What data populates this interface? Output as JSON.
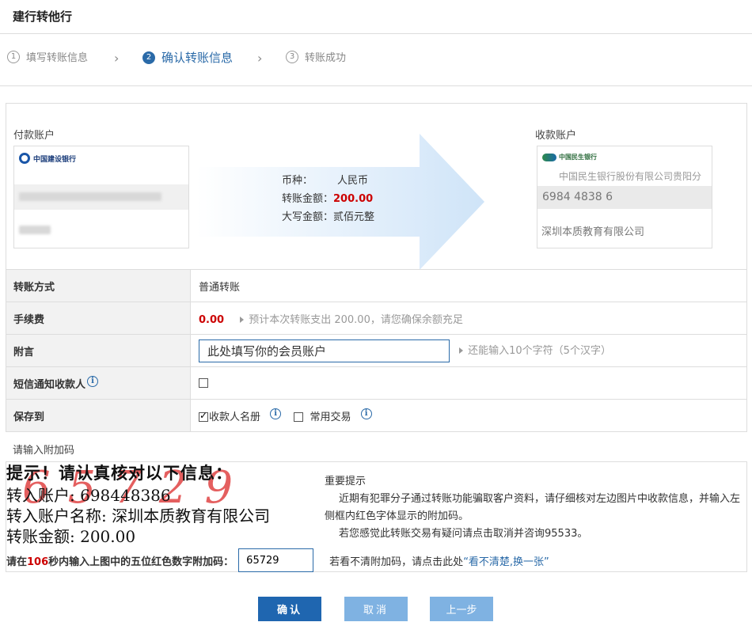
{
  "header": {
    "title": "建行转他行"
  },
  "steps": [
    {
      "num": "1",
      "label": "填写转账信息"
    },
    {
      "num": "2",
      "label": "确认转账信息"
    },
    {
      "num": "3",
      "label": "转账成功"
    }
  ],
  "step_separator": "›",
  "payer": {
    "label": "付款账户",
    "bank_logo_text": "中国建设银行"
  },
  "payee": {
    "label": "收款账户",
    "bank_logo_text": "中国民生银行",
    "bank_name": "中国民生银行股份有限公司贵阳分",
    "account_no": "6984 4838 6",
    "account_name": "深圳本质教育有限公司"
  },
  "amount": {
    "currency_label": "币种：",
    "currency_value": "人民币",
    "amount_label": "转账金额：",
    "amount_value": "200.00",
    "capital_label": "大写金额：",
    "capital_value": "贰佰元整"
  },
  "form": {
    "method_label": "转账方式",
    "method_value": "普通转账",
    "fee_label": "手续费",
    "fee_value": "0.00",
    "fee_hint": "预计本次转账支出 200.00，请您确保余额充足",
    "memo_label": "附言",
    "memo_value": "此处填写你的会员账户",
    "memo_hint": "还能输入10个字符（5个汉字）",
    "sms_label": "短信通知收款人",
    "save_label": "保存到",
    "save_opt1": "收款人名册",
    "save_opt2": "常用交易"
  },
  "captcha": {
    "label": "请输入附加码",
    "img_line1": "提示！请认真核对以下信息：",
    "img_line2": "转入账户: 698448386",
    "img_line3": "转入账户名称: 深圳本质教育有限公司",
    "img_line4": "转账金额: 200.00",
    "img_digits": "65729",
    "notice_title": "重要提示",
    "notice_p1": "近期有犯罪分子通过转账功能骗取客户资料，请仔细核对左边图片中收款信息，并输入左侧框内红色字体显示的附加码。",
    "notice_p2": "若您感觉此转账交易有疑问请点击取消并咨询95533。",
    "prompt_pre": "请在",
    "prompt_secs": "106",
    "prompt_post": "秒内输入上图中的五位红色数字附加码：",
    "input_value": "65729",
    "refresh_pre": "若看不清附加码，请点击此处",
    "refresh_link": "“看不清楚,换一张”"
  },
  "buttons": {
    "confirm": "确认",
    "cancel": "取消",
    "back": "上一步"
  },
  "colors": {
    "primary": "#1f66b0",
    "accent_red": "#cc0000",
    "light_button": "#7fb2e2"
  }
}
